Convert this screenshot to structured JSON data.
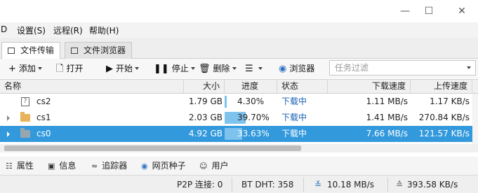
{
  "window": {
    "controls": {
      "minimize": "—",
      "maximize": "☐",
      "close": "✕"
    }
  },
  "menu": {
    "items": [
      "D",
      "设置(S)",
      "远程(R)",
      "帮助(H)"
    ]
  },
  "tabs": [
    {
      "label": "文件传输",
      "icon": "file-transfer-icon"
    },
    {
      "label": "文件浏览器",
      "icon": "file-browser-icon"
    }
  ],
  "toolbar": {
    "add": "添加",
    "open": "打开",
    "start": "开始",
    "stop": "停止",
    "delete": "删除",
    "browser": "浏览器",
    "filter_placeholder": "任务过滤"
  },
  "table": {
    "columns": [
      "名称",
      "大小",
      "进度",
      "状态",
      "下载速度",
      "上传速度"
    ],
    "rows": [
      {
        "name": "cs2",
        "size": "1.79 GB",
        "progress": "4.30%",
        "progress_value": 4.3,
        "status": "下载中",
        "down": "1.11 MB/s",
        "up": "1.17 KB/s",
        "icon": "file-icon",
        "selected": false
      },
      {
        "name": "cs1",
        "size": "2.03 GB",
        "progress": "39.70%",
        "progress_value": 39.7,
        "status": "下载中",
        "down": "1.41 MB/s",
        "up": "270.84 KB/s",
        "icon": "folder-icon",
        "selected": false
      },
      {
        "name": "cs0",
        "size": "4.92 GB",
        "progress": "33.63%",
        "progress_value": 33.63,
        "status": "下载中",
        "down": "7.66 MB/s",
        "up": "121.57 KB/s",
        "icon": "folder-icon",
        "selected": true
      }
    ]
  },
  "bottom_tabs": [
    "属性",
    "信息",
    "追踪器",
    "网页种子",
    "用户"
  ],
  "statusbar": {
    "p2p": "P2P 连接:  0",
    "dht": "BT DHT:  358",
    "down": "10.18 MB/s",
    "up": "393.58 KB/s"
  },
  "colors": {
    "selection": "#3399dd",
    "progress": "#7ec2ee",
    "status_text": "#1a5fb4"
  }
}
